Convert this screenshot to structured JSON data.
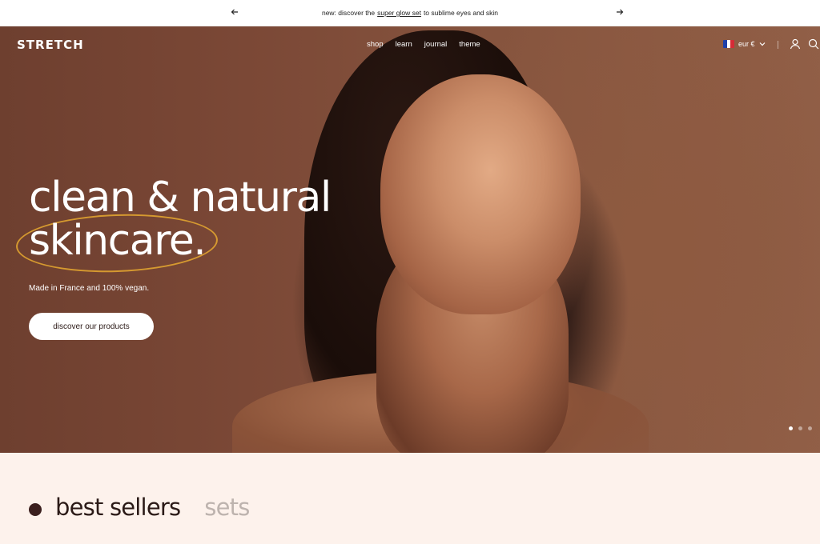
{
  "announcement": {
    "prefix": "new: discover the",
    "link": "super glow set",
    "suffix": "to sublime eyes and skin"
  },
  "header": {
    "logo": "STRETCH",
    "menu": [
      "shop",
      "learn",
      "journal",
      "theme"
    ],
    "currency": "eur €",
    "flag_colors": [
      "#1f3fa8",
      "#ffffff",
      "#d62b36"
    ]
  },
  "hero": {
    "headline_line1": "clean & natural",
    "headline_line2": "skincare.",
    "tagline": "Made in France and 100% vegan.",
    "cta": "discover our products",
    "slides": 3,
    "active_slide": 1,
    "accent_color": "#e0a330"
  },
  "collections": {
    "tabs": [
      "best sellers",
      "sets"
    ],
    "active_tab": "best sellers"
  }
}
